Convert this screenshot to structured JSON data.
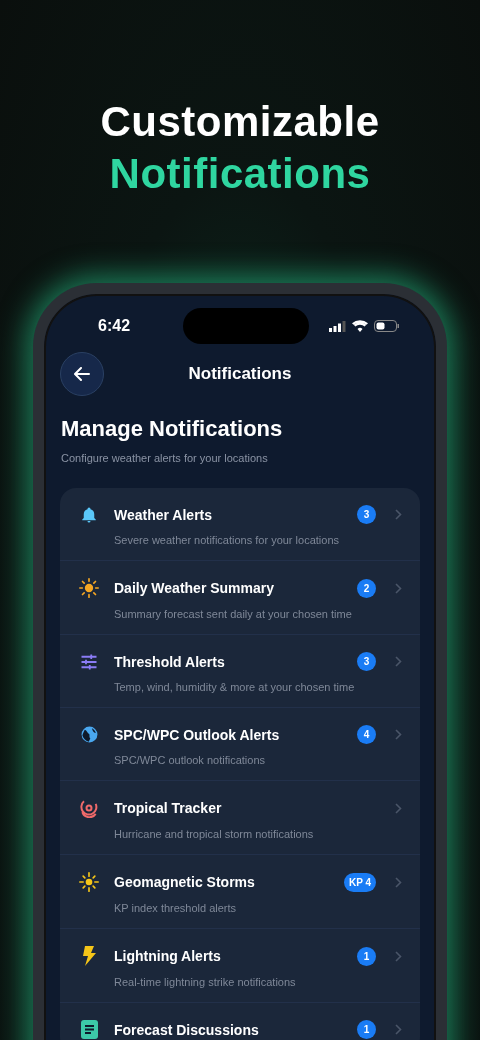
{
  "headline": {
    "line_1": "Customizable",
    "line_2": "Notifications"
  },
  "status_bar": {
    "time": "6:42"
  },
  "nav": {
    "title": "Notifications"
  },
  "header": {
    "title": "Manage Notifications",
    "subtitle": "Configure weather alerts for your locations"
  },
  "items": [
    {
      "title": "Weather Alerts",
      "subtitle": "Severe weather notifications for your locations",
      "badge": "3"
    },
    {
      "title": "Daily Weather Summary",
      "subtitle": "Summary forecast sent daily at your chosen time",
      "badge": "2"
    },
    {
      "title": "Threshold Alerts",
      "subtitle": "Temp, wind, humidity & more at your chosen time",
      "badge": "3"
    },
    {
      "title": "SPC/WPC Outlook Alerts",
      "subtitle": "SPC/WPC outlook notifications",
      "badge": "4"
    },
    {
      "title": "Tropical Tracker",
      "subtitle": "Hurricane and tropical storm notifications"
    },
    {
      "title": "Geomagnetic Storms",
      "subtitle": "KP index threshold alerts",
      "badge": "KP 4"
    },
    {
      "title": "Lightning Alerts",
      "subtitle": "Real-time lightning strike notifications",
      "badge": "1"
    },
    {
      "title": "Forecast Discussions",
      "badge": "1"
    }
  ]
}
